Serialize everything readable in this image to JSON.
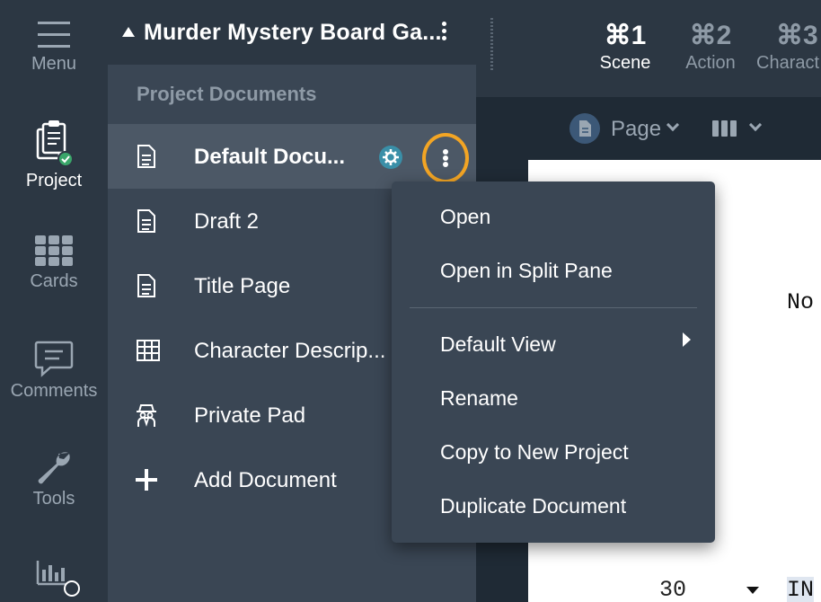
{
  "rail": {
    "items": [
      {
        "label": "Menu",
        "icon": "hamburger-icon",
        "active": false
      },
      {
        "label": "Project",
        "icon": "project-docs-icon",
        "active": true
      },
      {
        "label": "Cards",
        "icon": "cards-grid-icon",
        "active": false
      },
      {
        "label": "Comments",
        "icon": "comment-icon",
        "active": false
      },
      {
        "label": "Tools",
        "icon": "wrench-icon",
        "active": false
      },
      {
        "label": "",
        "icon": "stats-icon",
        "active": false
      }
    ]
  },
  "sidebar": {
    "project_title": "Murder Mystery Board Ga...",
    "section_title": "Project Documents",
    "documents": [
      {
        "label": "Default Docu...",
        "icon": "document-icon",
        "selected": true
      },
      {
        "label": "Draft 2",
        "icon": "document-icon",
        "selected": false
      },
      {
        "label": "Title Page",
        "icon": "document-icon",
        "selected": false
      },
      {
        "label": "Character Descrip...",
        "icon": "table-icon",
        "selected": false
      },
      {
        "label": "Private Pad",
        "icon": "spy-icon",
        "selected": false
      },
      {
        "label": "Add Document",
        "icon": "plus-icon",
        "selected": false
      }
    ]
  },
  "toolbar": {
    "tabs": [
      {
        "key": "⌘1",
        "name": "Scene",
        "active": true
      },
      {
        "key": "⌘2",
        "name": "Action",
        "active": false
      },
      {
        "key": "⌘3",
        "name": "Charact",
        "active": false
      }
    ],
    "view_label": "Page"
  },
  "editor": {
    "line_text_1": "No",
    "line_number": "30",
    "line_text_2": "IN"
  },
  "context_menu": {
    "items": [
      "Open",
      "Open in Split Pane",
      "Default View",
      "Rename",
      "Copy to New Project",
      "Duplicate Document"
    ]
  },
  "colors": {
    "highlight_ring": "#f3a524",
    "badge": "#3a8fa8",
    "status_check": "#3aa66a"
  }
}
